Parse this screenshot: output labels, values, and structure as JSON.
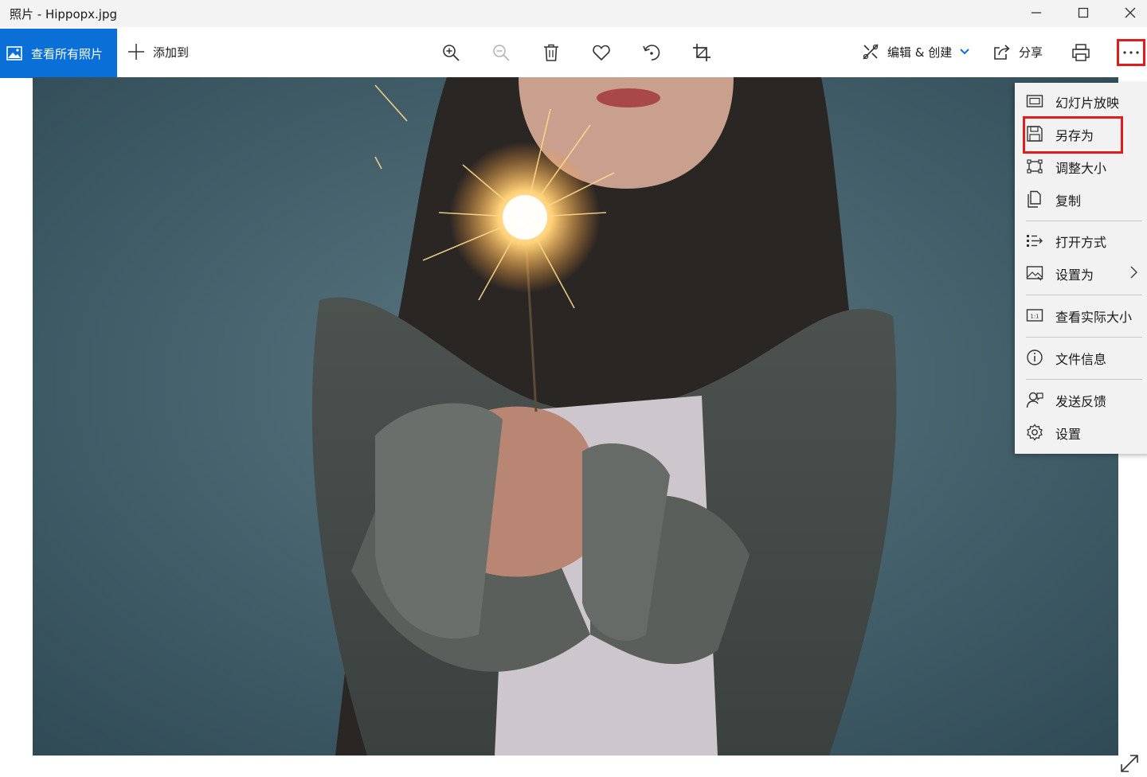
{
  "window": {
    "title": "照片 - Hippopx.jpg",
    "controls": [
      "minimize-icon",
      "maximize-icon",
      "close-icon"
    ]
  },
  "toolbar": {
    "view_all_label": "查看所有照片",
    "add_to_label": "添加到",
    "tools": [
      "zoom-in-icon",
      "zoom-out-icon",
      "delete-icon",
      "favorite-icon",
      "rotate-icon",
      "crop-icon"
    ],
    "edit_create_label": "编辑 & 创建",
    "share_label": "分享",
    "print_icon": "print-icon",
    "more_icon": "more-icon"
  },
  "photo": {
    "file_name": "Hippopx.jpg",
    "expand_icon": "expand-icon"
  },
  "menu": {
    "items": [
      {
        "label": "幻灯片放映",
        "icon": "slideshow-icon"
      },
      {
        "label": "另存为",
        "icon": "save-as-icon"
      },
      {
        "label": "调整大小",
        "icon": "resize-icon"
      },
      {
        "label": "复制",
        "icon": "copy-icon"
      },
      {
        "label": "打开方式",
        "icon": "open-with-icon"
      },
      {
        "label": "设置为",
        "icon": "set-as-icon"
      },
      {
        "label": "查看实际大小",
        "icon": "actual-size-icon"
      },
      {
        "label": "文件信息",
        "icon": "info-icon"
      },
      {
        "label": "发送反馈",
        "icon": "feedback-icon"
      },
      {
        "label": "设置",
        "icon": "settings-icon"
      }
    ]
  },
  "colors": {
    "accent": "#0a6fd6",
    "highlight_border": "#e11c1c",
    "menu_bg": "#f2f2f2"
  }
}
